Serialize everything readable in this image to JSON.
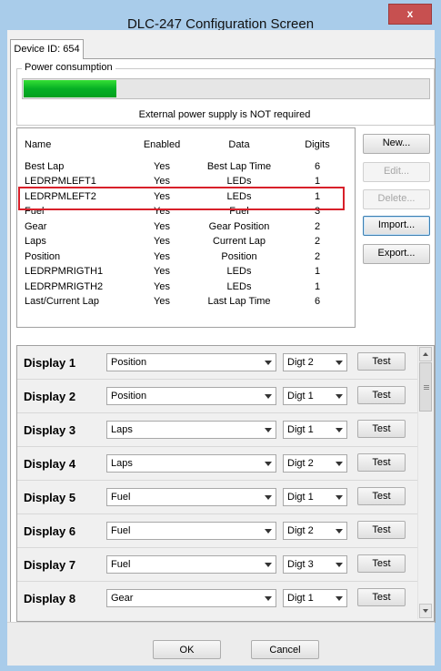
{
  "window": {
    "title": "DLC-247 Configuration Screen",
    "close_glyph": "x"
  },
  "tab": {
    "label": "Device ID: 654"
  },
  "power": {
    "legend": "Power consumption",
    "progress_percent": 23,
    "message": "External power supply is NOT required"
  },
  "table": {
    "headers": {
      "name": "Name",
      "enabled": "Enabled",
      "data": "Data",
      "digits": "Digits"
    },
    "rows": [
      {
        "name": "Best Lap",
        "enabled": "Yes",
        "data": "Best Lap Time",
        "digits": "6"
      },
      {
        "name": "LEDRPMLEFT1",
        "enabled": "Yes",
        "data": "LEDs",
        "digits": "1"
      },
      {
        "name": "LEDRPMLEFT2",
        "enabled": "Yes",
        "data": "LEDs",
        "digits": "1"
      },
      {
        "name": "Fuel",
        "enabled": "Yes",
        "data": "Fuel",
        "digits": "3"
      },
      {
        "name": "Gear",
        "enabled": "Yes",
        "data": "Gear Position",
        "digits": "2"
      },
      {
        "name": "Laps",
        "enabled": "Yes",
        "data": "Current Lap",
        "digits": "2"
      },
      {
        "name": "Position",
        "enabled": "Yes",
        "data": "Position",
        "digits": "2"
      },
      {
        "name": "LEDRPMRIGTH1",
        "enabled": "Yes",
        "data": "LEDs",
        "digits": "1"
      },
      {
        "name": "LEDRPMRIGTH2",
        "enabled": "Yes",
        "data": "LEDs",
        "digits": "1"
      },
      {
        "name": "Last/Current Lap",
        "enabled": "Yes",
        "data": "Last Lap Time",
        "digits": "6"
      }
    ]
  },
  "side_buttons": {
    "new": "New...",
    "edit": "Edit...",
    "delete": "Delete...",
    "import": "Import...",
    "export": "Export..."
  },
  "displays": [
    {
      "label": "Display 1",
      "source": "Position",
      "digit": "Digt 2",
      "test": "Test"
    },
    {
      "label": "Display 2",
      "source": "Position",
      "digit": "Digt 1",
      "test": "Test"
    },
    {
      "label": "Display 3",
      "source": "Laps",
      "digit": "Digt 1",
      "test": "Test"
    },
    {
      "label": "Display 4",
      "source": "Laps",
      "digit": "Digt 2",
      "test": "Test"
    },
    {
      "label": "Display 5",
      "source": "Fuel",
      "digit": "Digt 1",
      "test": "Test"
    },
    {
      "label": "Display 6",
      "source": "Fuel",
      "digit": "Digt 2",
      "test": "Test"
    },
    {
      "label": "Display 7",
      "source": "Fuel",
      "digit": "Digt 3",
      "test": "Test"
    },
    {
      "label": "Display 8",
      "source": "Gear",
      "digit": "Digt 1",
      "test": "Test"
    }
  ],
  "footer": {
    "ok": "OK",
    "cancel": "Cancel"
  },
  "colors": {
    "frame": "#a9ccea",
    "progress": "#06b025",
    "highlight": "#d8202a",
    "close": "#c75050"
  },
  "icons": {
    "close": "close-icon",
    "dropdown": "chevron-down-icon"
  }
}
